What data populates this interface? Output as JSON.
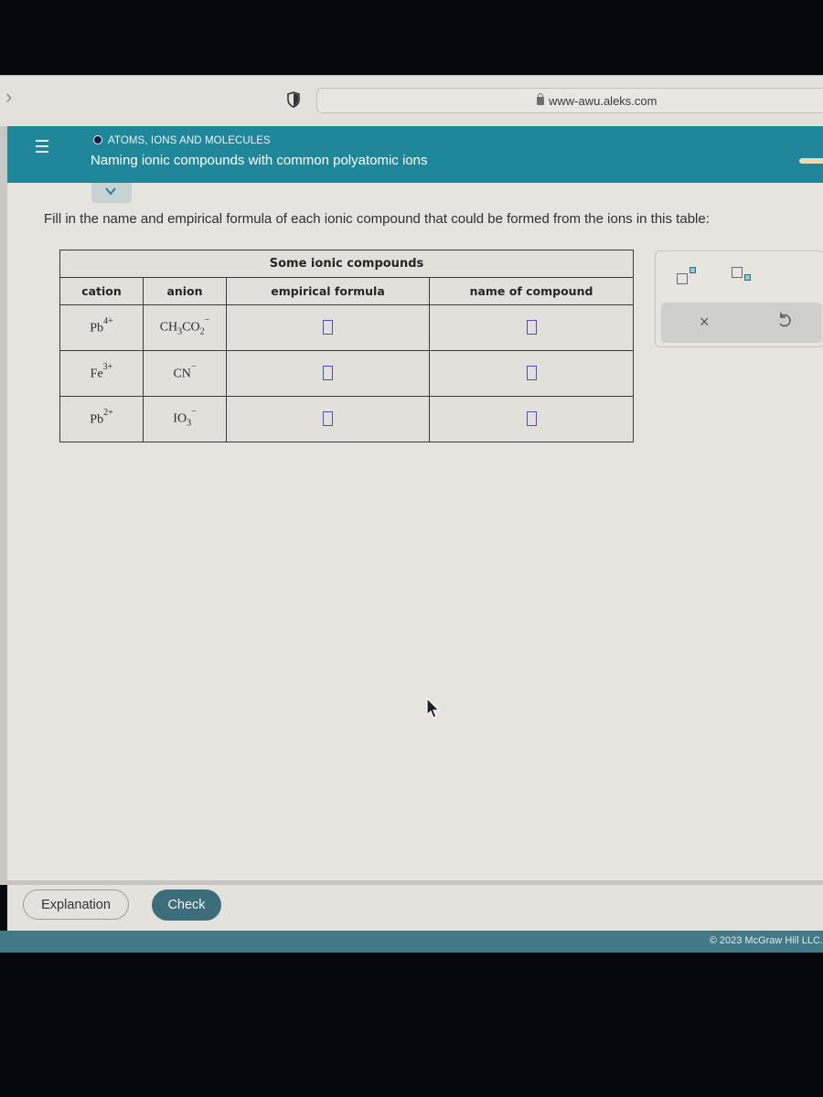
{
  "browser": {
    "url": "www-awu.aleks.com"
  },
  "header": {
    "topic": "ATOMS, IONS AND MOLECULES",
    "title": "Naming ionic compounds with common polyatomic ions"
  },
  "instruction": "Fill in the name and empirical formula of each ionic compound that could be formed from the ions in this table:",
  "table": {
    "caption": "Some ionic compounds",
    "columns": {
      "cation": "cation",
      "anion": "anion",
      "formula": "empirical formula",
      "name": "name of compound"
    },
    "rows": [
      {
        "cation": {
          "symbol": "Pb",
          "charge": "4+"
        },
        "anion": {
          "parts": [
            "CH",
            "3",
            "CO",
            "2"
          ],
          "charge": "−"
        },
        "formula": "",
        "name": ""
      },
      {
        "cation": {
          "symbol": "Fe",
          "charge": "3+"
        },
        "anion": {
          "parts": [
            "CN",
            "",
            "",
            ""
          ],
          "charge": "−"
        },
        "formula": "",
        "name": ""
      },
      {
        "cation": {
          "symbol": "Pb",
          "charge": "2+"
        },
        "anion": {
          "parts": [
            "IO",
            "3",
            "",
            ""
          ],
          "charge": "−"
        },
        "formula": "",
        "name": ""
      }
    ]
  },
  "tools": {
    "superscript": "superscript-tool",
    "subscript": "subscript-tool",
    "clear": "×",
    "undo": "undo"
  },
  "buttons": {
    "explanation": "Explanation",
    "check": "Check"
  },
  "footer": {
    "copyright": "© 2023 McGraw Hill LLC."
  },
  "colors": {
    "header": "#1f8799",
    "check_button": "#3b6d7b",
    "answer_box": "#4a4fc0"
  }
}
